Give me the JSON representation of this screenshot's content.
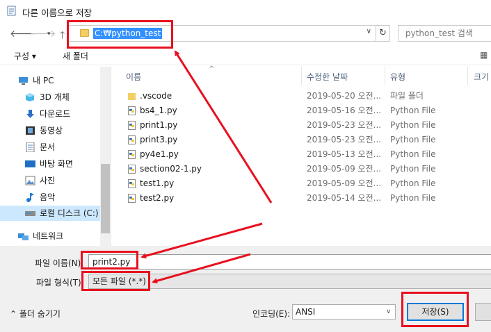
{
  "window": {
    "title": "다른 이름으로 저장"
  },
  "nav": {
    "back_icon": "arrow-left-icon",
    "forward_icon": "arrow-right-icon",
    "recent_icon": "chevron-down-icon",
    "up_icon": "arrow-up-icon",
    "address_path": "C:₩python_test",
    "refresh_icon": "refresh-icon",
    "search_placeholder": "python_test 검색"
  },
  "toolbar": {
    "organize_label": "구성 ▾",
    "new_folder_label": "새 폴더"
  },
  "sidebar": {
    "items": [
      {
        "label": "내 PC",
        "icon": "pc-icon"
      },
      {
        "label": "3D 개체",
        "icon": "cube-icon"
      },
      {
        "label": "다운로드",
        "icon": "download-icon"
      },
      {
        "label": "동영상",
        "icon": "film-icon"
      },
      {
        "label": "문서",
        "icon": "document-icon"
      },
      {
        "label": "바탕 화면",
        "icon": "desktop-icon"
      },
      {
        "label": "사진",
        "icon": "picture-icon"
      },
      {
        "label": "음악",
        "icon": "music-icon"
      },
      {
        "label": "로컬 디스크 (C:)",
        "icon": "disk-icon"
      },
      {
        "label": "네트워크",
        "icon": "network-icon"
      }
    ]
  },
  "filelist": {
    "columns": {
      "name": "이름",
      "modified": "수정한 날짜",
      "type": "유형",
      "size": "크기"
    },
    "rows": [
      {
        "name": ".vscode",
        "modified": "2019-05-20 오전...",
        "type": "파일 폴더",
        "icon": "folder-icon"
      },
      {
        "name": "bs4_1.py",
        "modified": "2019-05-16 오전...",
        "type": "Python File",
        "icon": "python-file-icon"
      },
      {
        "name": "print1.py",
        "modified": "2019-05-23 오전...",
        "type": "Python File",
        "icon": "python-file-icon"
      },
      {
        "name": "print3.py",
        "modified": "2019-05-23 오전...",
        "type": "Python File",
        "icon": "python-file-icon"
      },
      {
        "name": "py4e1.py",
        "modified": "2019-05-13 오전...",
        "type": "Python File",
        "icon": "python-file-icon"
      },
      {
        "name": "section02-1.py",
        "modified": "2019-05-09 오전...",
        "type": "Python File",
        "icon": "python-file-icon"
      },
      {
        "name": "test1.py",
        "modified": "2019-05-09 오전...",
        "type": "Python File",
        "icon": "python-file-icon"
      },
      {
        "name": "test2.py",
        "modified": "2019-05-14 오전...",
        "type": "Python File",
        "icon": "python-file-icon"
      }
    ]
  },
  "form": {
    "filename_label": "파일 이름(N):",
    "filename_value": "print2.py",
    "filetype_label": "파일 형식(T):",
    "filetype_value": "모든 파일 (*.*)",
    "hide_folders_label": "폴더 숨기기",
    "encoding_label": "인코딩(E):",
    "encoding_value": "ANSI",
    "save_label": "저장(S)"
  },
  "colors": {
    "highlight": "#e8101e",
    "selection": "#3390ff"
  }
}
